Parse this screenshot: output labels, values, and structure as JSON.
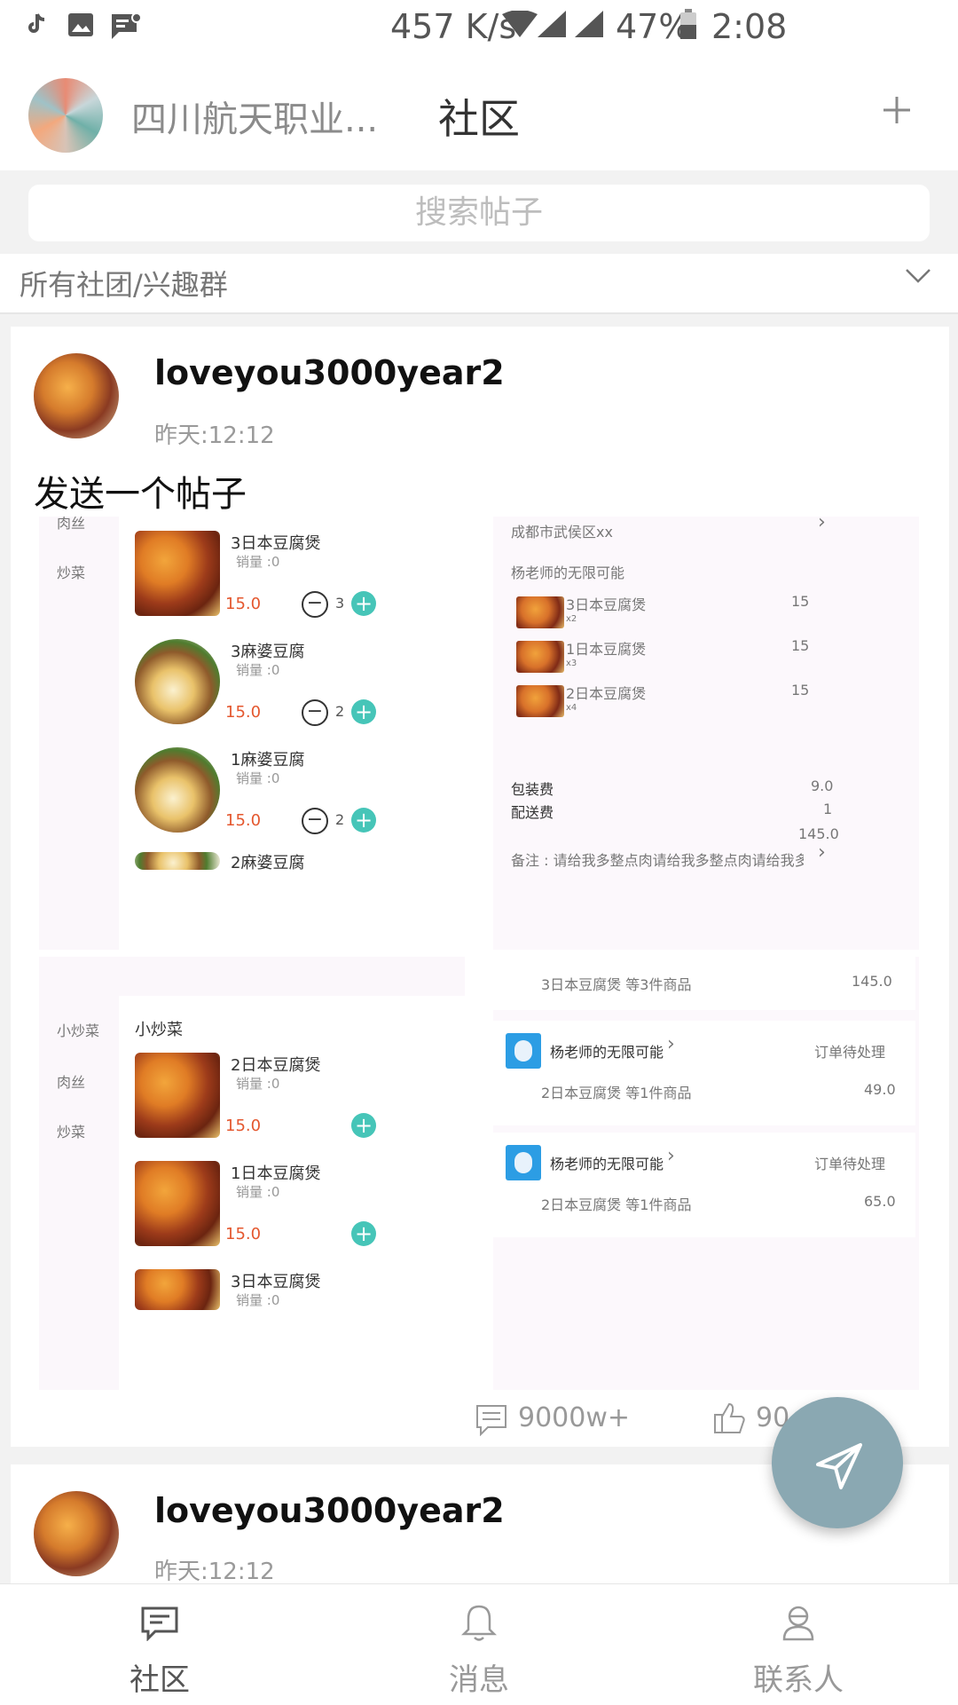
{
  "status_bar": {
    "network_speed": "457 K/s",
    "battery": "47%",
    "time": "2:08"
  },
  "header": {
    "school": "四川航天职业...",
    "title": "社区"
  },
  "search": {
    "placeholder": "搜索帖子"
  },
  "filter": {
    "label": "所有社团/兴趣群"
  },
  "post1": {
    "username": "loveyou3000year2",
    "time": "昨天:12:12",
    "text": "发送一个帖子",
    "comments": "9000w+",
    "likes": "90"
  },
  "post2": {
    "username": "loveyou3000year2",
    "time": "昨天:12:12"
  },
  "shot": {
    "tl": {
      "cats": [
        "肉丝",
        "炒菜"
      ],
      "items": [
        {
          "name": "3日本豆腐煲",
          "sales": "销量 :0",
          "price": "15.0",
          "qty": "3"
        },
        {
          "name": "3麻婆豆腐",
          "sales": "销量 :0",
          "price": "15.0",
          "qty": "2"
        },
        {
          "name": "1麻婆豆腐",
          "sales": "销量 :0",
          "price": "15.0",
          "qty": "2"
        },
        {
          "name": "2麻婆豆腐"
        }
      ]
    },
    "tr": {
      "address": "成都市武侯区xx",
      "shop": "杨老师的无限可能",
      "lines": [
        {
          "name": "3日本豆腐煲",
          "count": "x2",
          "price": "15"
        },
        {
          "name": "1日本豆腐煲",
          "count": "x3",
          "price": "15"
        },
        {
          "name": "2日本豆腐煲",
          "count": "x4",
          "price": "15"
        }
      ],
      "packing_label": "包装费",
      "packing_value": "9.0",
      "delivery_label": "配送费",
      "delivery_value": "1",
      "total": "145.0",
      "note": "备注 : 请给我多整点肉请给我多整点肉请给我多整点肉"
    },
    "bl": {
      "cats": [
        "小炒菜",
        "肉丝",
        "炒菜"
      ],
      "section": "小炒菜",
      "items": [
        {
          "name": "2日本豆腐煲",
          "sales": "销量 :0",
          "price": "15.0"
        },
        {
          "name": "1日本豆腐煲",
          "sales": "销量 :0",
          "price": "15.0"
        },
        {
          "name": "3日本豆腐煲",
          "sales": "销量 :0"
        }
      ]
    },
    "br": {
      "first_summary": "3日本豆腐煲 等3件商品",
      "first_amount": "145.0",
      "orders": [
        {
          "shop": "杨老师的无限可能",
          "status": "订单待处理",
          "summary": "2日本豆腐煲 等1件商品",
          "amount": "49.0"
        },
        {
          "shop": "杨老师的无限可能",
          "status": "订单待处理",
          "summary": "2日本豆腐煲 等1件商品",
          "amount": "65.0"
        }
      ]
    }
  },
  "nav": {
    "community": "社区",
    "messages": "消息",
    "contacts": "联系人"
  },
  "colors": {
    "accent_teal": "#46c5b8",
    "price_red": "#e4572e",
    "fab": "#8aa8b2"
  }
}
